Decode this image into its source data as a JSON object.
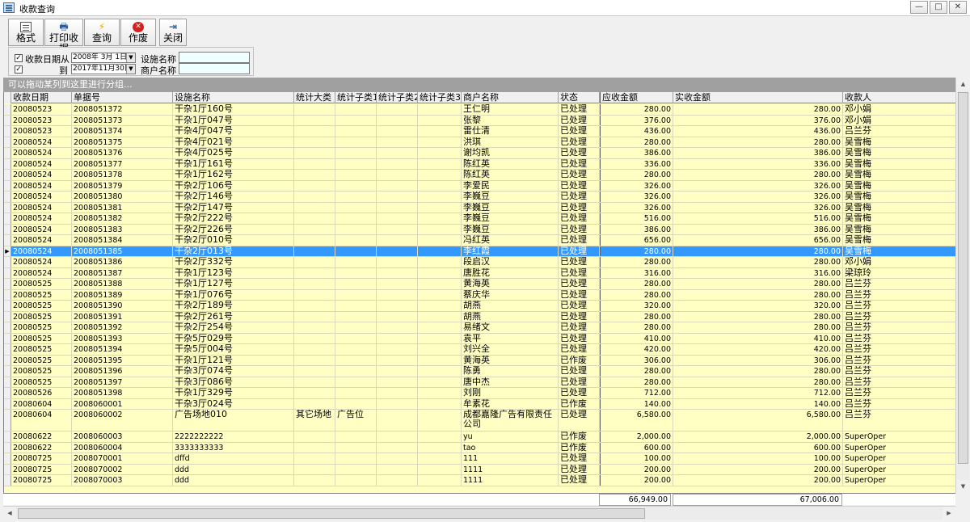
{
  "window": {
    "title": "收款查询",
    "min": "—",
    "max": "□",
    "close": "✕"
  },
  "toolbar": {
    "format": "格式",
    "print": "打印收据",
    "query": "查询",
    "void": "作废",
    "close": "关闭"
  },
  "filter": {
    "date_from_label": "收款日期从",
    "date_to_label": "到",
    "date_from": "2008年 3月 1日",
    "date_to": "2017年11月30日",
    "facility_label": "设施名称",
    "merchant_label": "商户名称",
    "date_from_checked": true,
    "date_to_checked": true
  },
  "group_hint": "可以拖动某列到这里进行分组...",
  "columns": [
    "收款日期",
    "单据号",
    "设施名称",
    "统计大类",
    "统计子类1",
    "统计子类2",
    "统计子类3",
    "商户名称",
    "状态",
    "应收金额",
    "实收金额",
    "收款人"
  ],
  "rows": [
    [
      "20080523",
      "2008051372",
      "干杂1厅160号",
      "",
      "",
      "",
      "",
      "王仁明",
      "已处理",
      "280.00",
      "280.00",
      "邓小娟"
    ],
    [
      "20080523",
      "2008051373",
      "干杂1厅047号",
      "",
      "",
      "",
      "",
      "张黎",
      "已处理",
      "376.00",
      "376.00",
      "邓小娟"
    ],
    [
      "20080523",
      "2008051374",
      "干杂4厅047号",
      "",
      "",
      "",
      "",
      "雷仕清",
      "已处理",
      "436.00",
      "436.00",
      "吕兰芬"
    ],
    [
      "20080524",
      "2008051375",
      "干杂4厅021号",
      "",
      "",
      "",
      "",
      "洪琪",
      "已处理",
      "280.00",
      "280.00",
      "吴雪梅"
    ],
    [
      "20080524",
      "2008051376",
      "干杂4厅025号",
      "",
      "",
      "",
      "",
      "谢均凯",
      "已处理",
      "386.00",
      "386.00",
      "吴雪梅"
    ],
    [
      "20080524",
      "2008051377",
      "干杂1厅161号",
      "",
      "",
      "",
      "",
      "陈红英",
      "已处理",
      "336.00",
      "336.00",
      "吴雪梅"
    ],
    [
      "20080524",
      "2008051378",
      "干杂1厅162号",
      "",
      "",
      "",
      "",
      "陈红英",
      "已处理",
      "280.00",
      "280.00",
      "吴雪梅"
    ],
    [
      "20080524",
      "2008051379",
      "干杂2厅106号",
      "",
      "",
      "",
      "",
      "李爱民",
      "已处理",
      "326.00",
      "326.00",
      "吴雪梅"
    ],
    [
      "20080524",
      "2008051380",
      "干杂2厅146号",
      "",
      "",
      "",
      "",
      "李巍豆",
      "已处理",
      "326.00",
      "326.00",
      "吴雪梅"
    ],
    [
      "20080524",
      "2008051381",
      "干杂2厅147号",
      "",
      "",
      "",
      "",
      "李巍豆",
      "已处理",
      "326.00",
      "326.00",
      "吴雪梅"
    ],
    [
      "20080524",
      "2008051382",
      "干杂2厅222号",
      "",
      "",
      "",
      "",
      "李巍豆",
      "已处理",
      "516.00",
      "516.00",
      "吴雪梅"
    ],
    [
      "20080524",
      "2008051383",
      "干杂2厅226号",
      "",
      "",
      "",
      "",
      "李巍豆",
      "已处理",
      "386.00",
      "386.00",
      "吴雪梅"
    ],
    [
      "20080524",
      "2008051384",
      "干杂2厅010号",
      "",
      "",
      "",
      "",
      "冯红英",
      "已处理",
      "656.00",
      "656.00",
      "吴雪梅"
    ],
    [
      "20080524",
      "2008051385",
      "干杂2厅013号",
      "",
      "",
      "",
      "",
      "李红霞",
      "已处理",
      "280.00",
      "280.00",
      "吴雪梅"
    ],
    [
      "20080524",
      "2008051386",
      "干杂2厅332号",
      "",
      "",
      "",
      "",
      "段启汉",
      "已处理",
      "280.00",
      "280.00",
      "邓小娟"
    ],
    [
      "20080524",
      "2008051387",
      "干杂1厅123号",
      "",
      "",
      "",
      "",
      "唐胜花",
      "已处理",
      "316.00",
      "316.00",
      "梁琼玲"
    ],
    [
      "20080525",
      "2008051388",
      "干杂1厅127号",
      "",
      "",
      "",
      "",
      "黄海英",
      "已处理",
      "280.00",
      "280.00",
      "吕兰芬"
    ],
    [
      "20080525",
      "2008051389",
      "干杂1厅076号",
      "",
      "",
      "",
      "",
      "蔡庆华",
      "已处理",
      "280.00",
      "280.00",
      "吕兰芬"
    ],
    [
      "20080525",
      "2008051390",
      "干杂2厅189号",
      "",
      "",
      "",
      "",
      "胡燕",
      "已处理",
      "320.00",
      "320.00",
      "吕兰芬"
    ],
    [
      "20080525",
      "2008051391",
      "干杂2厅261号",
      "",
      "",
      "",
      "",
      "胡燕",
      "已处理",
      "280.00",
      "280.00",
      "吕兰芬"
    ],
    [
      "20080525",
      "2008051392",
      "干杂2厅254号",
      "",
      "",
      "",
      "",
      "易绪文",
      "已处理",
      "280.00",
      "280.00",
      "吕兰芬"
    ],
    [
      "20080525",
      "2008051393",
      "干杂5厅029号",
      "",
      "",
      "",
      "",
      "袁平",
      "已处理",
      "410.00",
      "410.00",
      "吕兰芬"
    ],
    [
      "20080525",
      "2008051394",
      "干杂5厅004号",
      "",
      "",
      "",
      "",
      "刘兴全",
      "已处理",
      "420.00",
      "420.00",
      "吕兰芬"
    ],
    [
      "20080525",
      "2008051395",
      "干杂1厅121号",
      "",
      "",
      "",
      "",
      "黄海英",
      "已作废",
      "306.00",
      "306.00",
      "吕兰芬"
    ],
    [
      "20080525",
      "2008051396",
      "干杂3厅074号",
      "",
      "",
      "",
      "",
      "陈勇",
      "已处理",
      "280.00",
      "280.00",
      "吕兰芬"
    ],
    [
      "20080525",
      "2008051397",
      "干杂3厅086号",
      "",
      "",
      "",
      "",
      "唐中杰",
      "已处理",
      "280.00",
      "280.00",
      "吕兰芬"
    ],
    [
      "20080526",
      "2008051398",
      "干杂1厅329号",
      "",
      "",
      "",
      "",
      "刘刚",
      "已处理",
      "712.00",
      "712.00",
      "吕兰芬"
    ],
    [
      "20080604",
      "2008060001",
      "干杂3厅024号",
      "",
      "",
      "",
      "",
      "牟素花",
      "已作废",
      "140.00",
      "140.00",
      "吕兰芬"
    ],
    [
      "20080604",
      "2008060002",
      "广告场地010",
      "其它场地",
      "广告位",
      "",
      "",
      "成都嘉隆广告有限责任公司",
      "已处理",
      "6,580.00",
      "6,580.00",
      "吕兰芬"
    ],
    [
      "20080622",
      "2008060003",
      "2222222222",
      "",
      "",
      "",
      "",
      "yu",
      "已作废",
      "2,000.00",
      "2,000.00",
      "SuperOper"
    ],
    [
      "20080622",
      "2008060004",
      "3333333333",
      "",
      "",
      "",
      "",
      "tao",
      "已作废",
      "600.00",
      "600.00",
      "SuperOper"
    ],
    [
      "20080725",
      "2008070001",
      "dffd",
      "",
      "",
      "",
      "",
      "111",
      "已处理",
      "100.00",
      "100.00",
      "SuperOper"
    ],
    [
      "20080725",
      "2008070002",
      "ddd",
      "",
      "",
      "",
      "",
      "1111",
      "已处理",
      "200.00",
      "200.00",
      "SuperOper"
    ],
    [
      "20080725",
      "2008070003",
      "ddd",
      "",
      "",
      "",
      "",
      "1111",
      "已处理",
      "200.00",
      "200.00",
      "SuperOper"
    ]
  ],
  "selected_row": 13,
  "totals": {
    "receivable": "66,949.00",
    "received": "67,006.00"
  },
  "colors": {
    "grid_bg": "#ffffc4",
    "selection": "#3399ff",
    "group_bar": "#a0a0a0"
  }
}
